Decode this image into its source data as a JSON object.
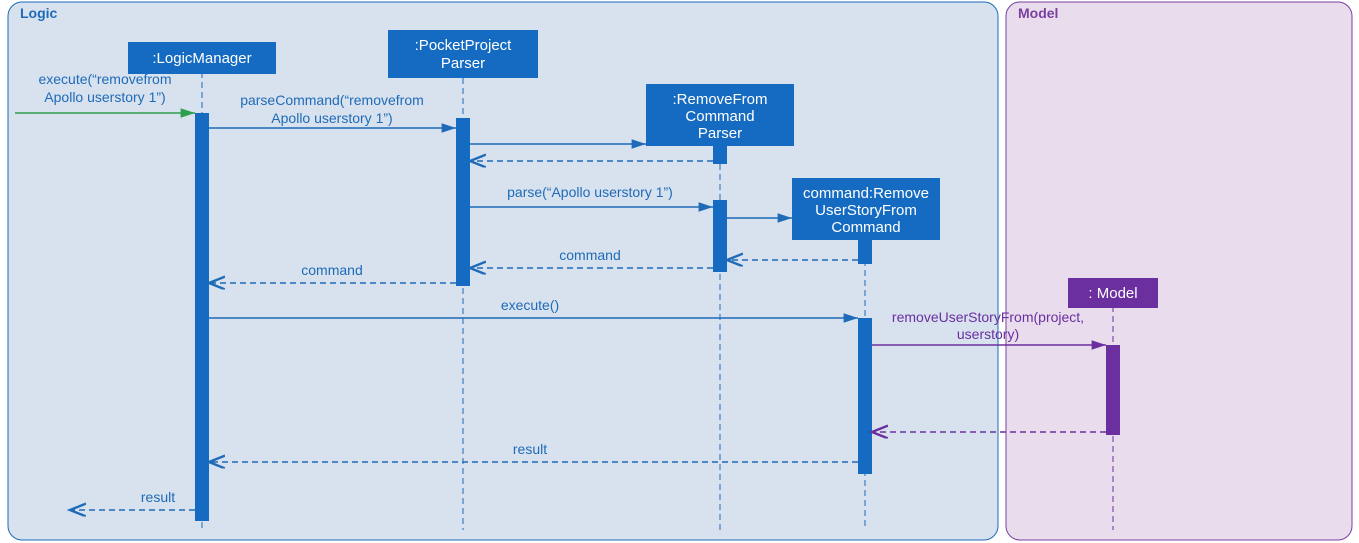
{
  "frames": {
    "logic": {
      "label": "Logic"
    },
    "model": {
      "label": "Model"
    }
  },
  "objects": {
    "logicManager": {
      "line1": ":LogicManager"
    },
    "pocketParser": {
      "line1": ":PocketProject",
      "line2": "Parser"
    },
    "removeParser": {
      "line1": ":RemoveFrom",
      "line2": "Command",
      "line3": "Parser"
    },
    "removeCommand": {
      "line1": "command:Remove",
      "line2": "UserStoryFrom",
      "line3": "Command"
    },
    "model": {
      "line1": ": Model"
    }
  },
  "messages": {
    "execIn1": "execute(“removefrom",
    "execIn2": "Apollo userstory 1”)",
    "parseCmd1": "parseCommand(“removefrom",
    "parseCmd2": "Apollo userstory 1”)",
    "parse": "parse(“Apollo userstory 1”)",
    "retCommand1": "command",
    "retCommand2": "command",
    "execute": "execute()",
    "removeCall1": "removeUserStoryFrom(project,",
    "removeCall2": "userstory)",
    "retResult1": "result",
    "retResult2": "result"
  },
  "colors": {
    "logicFill": "#d7e2ee",
    "logicStroke": "#1f6bb8",
    "modelFill": "#e8dced",
    "modelStroke": "#7b3fa0",
    "blue": "#156bc1",
    "blueDark": "#0f5ea8",
    "purple": "#6b2fa0",
    "green": "#2e9e4f"
  }
}
